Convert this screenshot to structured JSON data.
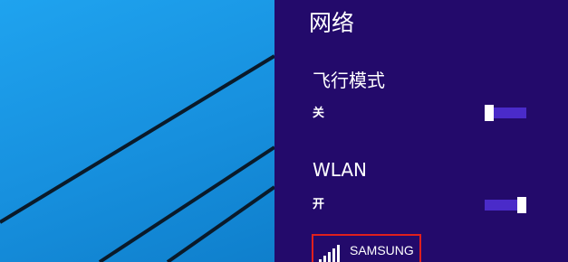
{
  "panel": {
    "title": "网络",
    "airplane_mode": {
      "label": "飞行模式",
      "state_label": "关",
      "on": false
    },
    "wlan": {
      "label": "WLAN",
      "state_label": "开",
      "on": true
    },
    "networks": [
      {
        "name": "SAMSUNG",
        "icon": "wifi-signal-icon",
        "selected": true
      }
    ]
  },
  "colors": {
    "panel_bg": "#230a6b",
    "toggle_track": "#4a2bc9",
    "highlight_border": "#e0201d",
    "desktop_bg": "#1a9ae8"
  }
}
